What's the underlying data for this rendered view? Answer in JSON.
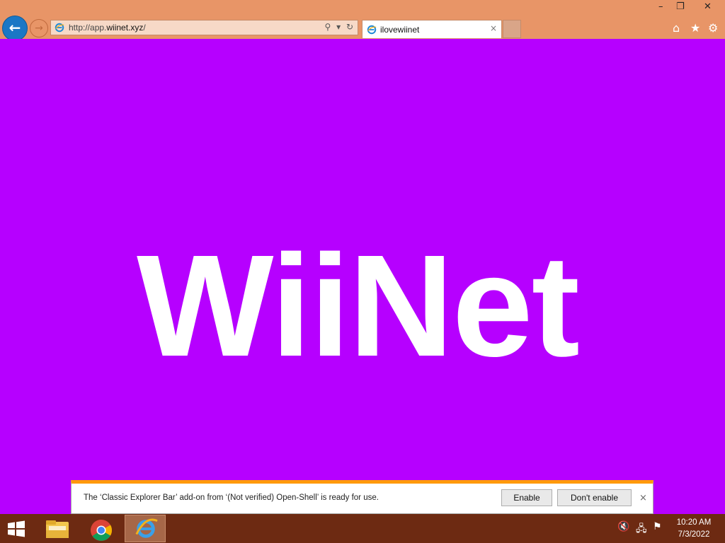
{
  "browser": {
    "address_prefix": "http://app.",
    "address_domain": "wiinet.xyz",
    "address_suffix": "/",
    "tab_title": "ilovewiinet",
    "tab_close": "×",
    "min_glyph": "–",
    "restore_glyph": "❐",
    "close_glyph": "✕",
    "search_glyph": "⚲",
    "dropdown_glyph": "▾",
    "refresh_glyph": "↻",
    "home_glyph": "⌂",
    "favorites_glyph": "★",
    "settings_glyph": "⚙"
  },
  "page": {
    "logo_text": "WiiNet",
    "background": "#b600ff"
  },
  "notification": {
    "message": "The ‘Classic Explorer Bar’ add-on from ‘(Not verified) Open-Shell’ is ready for use.",
    "enable_label": "Enable",
    "dont_enable_label": "Don't enable",
    "close_glyph": "×"
  },
  "taskbar": {
    "time": "10:20 AM",
    "date": "7/3/2022"
  },
  "icons": {
    "back": "back-arrow-icon",
    "forward": "forward-arrow-icon",
    "ie": "internet-explorer-icon",
    "chrome": "chrome-icon",
    "explorer": "file-explorer-icon",
    "start": "windows-start-icon",
    "volume": "volume-muted-icon",
    "network": "network-icon",
    "flag": "action-center-icon"
  }
}
